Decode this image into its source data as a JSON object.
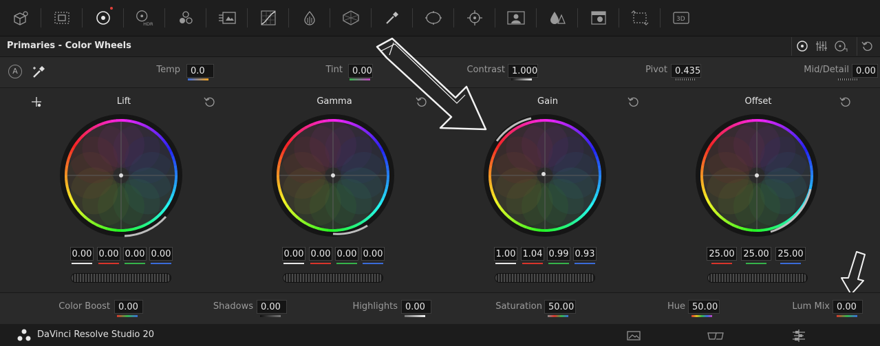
{
  "toolbar": {
    "icons": [
      "camera-raw-icon",
      "color-match-icon",
      "color-wheels-icon",
      "hdr-wheels-icon",
      "rgb-mixer-icon",
      "motion-effects-icon",
      "curves-icon",
      "warper-icon",
      "color-warper-icon",
      "qualifier-icon",
      "window-icon",
      "tracker-icon",
      "magic-mask-icon",
      "blur-icon",
      "key-icon",
      "sizing-icon",
      "3d-icon"
    ],
    "hdr_label": "HDR",
    "label_3d": "3D"
  },
  "panel": {
    "title": "Primaries - Color Wheels"
  },
  "params_top": [
    {
      "label": "Temp",
      "value": "0.0"
    },
    {
      "label": "Tint",
      "value": "0.00"
    },
    {
      "label": "Contrast",
      "value": "1.000"
    },
    {
      "label": "Pivot",
      "value": "0.435"
    },
    {
      "label": "Mid/Detail",
      "value": "0.00"
    }
  ],
  "auto_label": "A",
  "wheels": [
    {
      "title": "Lift",
      "values": [
        "0.00",
        "0.00",
        "0.00",
        "0.00"
      ]
    },
    {
      "title": "Gamma",
      "values": [
        "0.00",
        "0.00",
        "0.00",
        "0.00"
      ]
    },
    {
      "title": "Gain",
      "values": [
        "1.00",
        "1.04",
        "0.99",
        "0.93"
      ]
    },
    {
      "title": "Offset",
      "values": [
        "25.00",
        "25.00",
        "25.00"
      ]
    }
  ],
  "params_bottom": [
    {
      "label": "Color Boost",
      "value": "0.00"
    },
    {
      "label": "Shadows",
      "value": "0.00"
    },
    {
      "label": "Highlights",
      "value": "0.00"
    },
    {
      "label": "Saturation",
      "value": "50.00"
    },
    {
      "label": "Hue",
      "value": "50.00"
    },
    {
      "label": "Lum Mix",
      "value": "0.00"
    }
  ],
  "footer": {
    "app_name": "DaVinci Resolve Studio 20"
  },
  "colors": {
    "red": "#d9342b",
    "green": "#35b34a",
    "blue": "#3a6bd9",
    "white": "#e8e8e8",
    "accent_dot": "#e0403a"
  }
}
